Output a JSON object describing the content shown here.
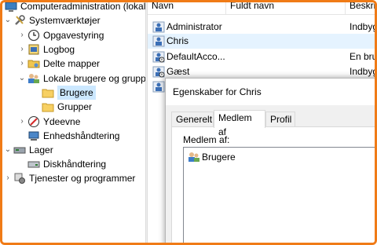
{
  "tree": {
    "root_label": "Computeradministration (lokal)",
    "items": [
      {
        "label": "Systemværktøjer",
        "icon": "tools-icon",
        "expanded": true
      },
      {
        "label": "Opgavestyring",
        "icon": "clock-icon"
      },
      {
        "label": "Logbog",
        "icon": "event-log-icon"
      },
      {
        "label": "Delte mapper",
        "icon": "shared-folder-icon"
      },
      {
        "label": "Lokale brugere og grupper",
        "icon": "users-icon",
        "expanded": true
      },
      {
        "label": "Brugere",
        "icon": "folder-icon",
        "selected": true
      },
      {
        "label": "Grupper",
        "icon": "folder-icon"
      },
      {
        "label": "Ydeevne",
        "icon": "performance-icon"
      },
      {
        "label": "Enhedshåndtering",
        "icon": "device-manager-icon"
      },
      {
        "label": "Lager",
        "icon": "storage-icon",
        "expanded": true
      },
      {
        "label": "Diskhåndtering",
        "icon": "disk-icon"
      },
      {
        "label": "Tjenester og programmer",
        "icon": "services-icon"
      }
    ]
  },
  "list": {
    "columns": [
      "Navn",
      "Fuldt navn",
      "Beskrivelse"
    ],
    "rows": [
      {
        "name": "Administrator",
        "full_name": "",
        "desc": "Indbygget"
      },
      {
        "name": "Chris",
        "full_name": "",
        "desc": ""
      },
      {
        "name": "DefaultAcco...",
        "full_name": "",
        "desc": "En brugerkonto"
      },
      {
        "name": "Gæst",
        "full_name": "",
        "desc": "Indbygget"
      }
    ]
  },
  "dialog": {
    "title": "Egenskaber for Chris",
    "tabs": [
      "Generelt",
      "Medlem af",
      "Profil"
    ],
    "active_tab": "Medlem af",
    "member_label": "Medlem af:",
    "members": [
      "Brugere"
    ]
  },
  "colors": {
    "frame_border": "#f07b17",
    "selection": "#cce8ff",
    "row_highlight": "#e5f3ff"
  }
}
